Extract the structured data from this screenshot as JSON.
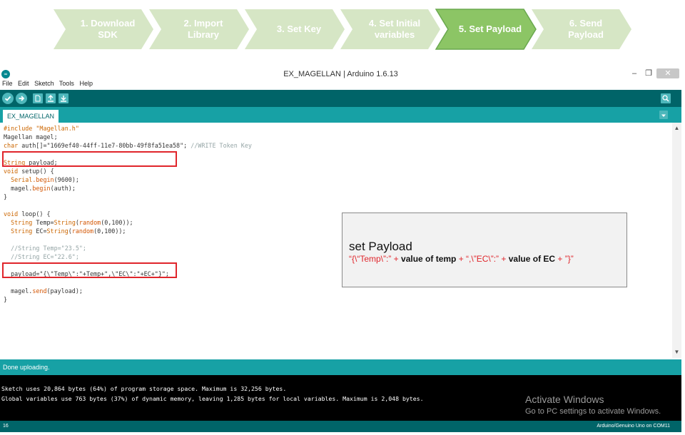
{
  "steps": [
    {
      "label": "1. Download\nSDK",
      "active": false
    },
    {
      "label": "2. Import\nLibrary",
      "active": false
    },
    {
      "label": "3. Set Key",
      "active": false
    },
    {
      "label": "4. Set Initial\nvariables",
      "active": false
    },
    {
      "label": "5. Set Payload",
      "active": true
    },
    {
      "label": "6. Send\nPayload",
      "active": false
    }
  ],
  "colors": {
    "step_inactive": "#d6e6c5",
    "step_active": "#8cc565",
    "arduino_dark": "#006468",
    "arduino_teal": "#17a1a5",
    "highlight_red": "#e0252b"
  },
  "window": {
    "title": "EX_MAGELLAN | Arduino 1.6.13",
    "icon": "arduino-logo-icon",
    "controls": {
      "minimize": "–",
      "maximize": "❐",
      "close": "✕"
    }
  },
  "menu": [
    "File",
    "Edit",
    "Sketch",
    "Tools",
    "Help"
  ],
  "toolbar": {
    "buttons": [
      "verify-icon",
      "upload-icon",
      "new-icon",
      "open-icon",
      "save-icon"
    ],
    "right": "serial-monitor-icon"
  },
  "tabs": {
    "active": "EX_MAGELLAN"
  },
  "code": {
    "l1": "#include \"Magellan.h\"",
    "l2": "Magellan magel;",
    "l3a": "char",
    "l3b": " auth[]=\"1669ef40-44ff-11e7-80bb-49f8fa51ea58\"; ",
    "l3c": "//WRITE Token Key",
    "l5a": "String",
    "l5b": " payload;",
    "l6a": "void",
    "l6b": " setup",
    "l6c": "() {",
    "l7a": "  Serial",
    "l7b": ".begin",
    "l7c": "(9600);",
    "l8a": "  magel.",
    "l8b": "begin",
    "l8c": "(auth);",
    "l9": "}",
    "l11a": "void",
    "l11b": " loop",
    "l11c": "() {",
    "l12a": "  String",
    "l12b": " Temp=",
    "l12c": "String",
    "l12d": "(",
    "l12e": "random",
    "l12f": "(0,100));",
    "l13a": "  String",
    "l13b": " EC=",
    "l13c": "String",
    "l13d": "(",
    "l13e": "random",
    "l13f": "(0,100));",
    "l15": "  //String Temp=\"23.5\";",
    "l16": "  //String EC=\"22.6\";",
    "l18": "  payload=\"{\\\"Temp\\\":\"+Temp+\",\\\"EC\\\":\"+EC+\"}\";",
    "l19a": "  magel.",
    "l19b": "send",
    "l19c": "(payload);",
    "l20": "}"
  },
  "callout": {
    "title": "set Payload",
    "f1": "“{\\“Temp\\”:” + ",
    "f2": "value of temp",
    "f3": " + “,\\”EC\\”:” + ",
    "f4": "value of EC",
    "f5": " + ”}”"
  },
  "status": {
    "message": "Done uploading."
  },
  "console": {
    "line1": "Sketch uses 20,864 bytes (64%) of program storage space. Maximum is 32,256 bytes.",
    "line2": "Global variables use 763 bytes (37%) of dynamic memory, leaving 1,285 bytes for local variables. Maximum is 2,048 bytes."
  },
  "footer": {
    "line": "16",
    "board": "Arduino/Genuino Uno on COM11"
  },
  "watermark": {
    "title": "Activate Windows",
    "subtitle": "Go to PC settings to activate Windows."
  }
}
